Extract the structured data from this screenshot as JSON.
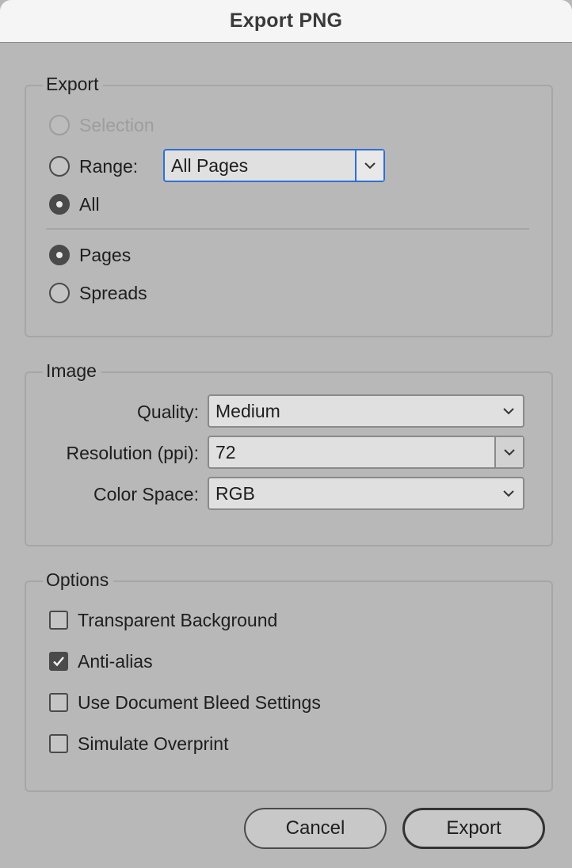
{
  "window": {
    "title": "Export PNG"
  },
  "export_group": {
    "legend": "Export",
    "selection_label": "Selection",
    "range_label": "Range:",
    "range_value": "All Pages",
    "all_label": "All",
    "pages_label": "Pages",
    "spreads_label": "Spreads"
  },
  "image_group": {
    "legend": "Image",
    "quality_label": "Quality:",
    "quality_value": "Medium",
    "resolution_label": "Resolution (ppi):",
    "resolution_value": "72",
    "color_space_label": "Color Space:",
    "color_space_value": "RGB"
  },
  "options_group": {
    "legend": "Options",
    "items": [
      {
        "label": "Transparent Background",
        "checked": false
      },
      {
        "label": "Anti-alias",
        "checked": true
      },
      {
        "label": "Use Document Bleed Settings",
        "checked": false
      },
      {
        "label": "Simulate Overprint",
        "checked": false
      }
    ]
  },
  "buttons": {
    "cancel": "Cancel",
    "export": "Export"
  },
  "colors": {
    "background": "#b8b8b8",
    "focus": "#2f6fd4",
    "control": "#4a4a4a"
  }
}
